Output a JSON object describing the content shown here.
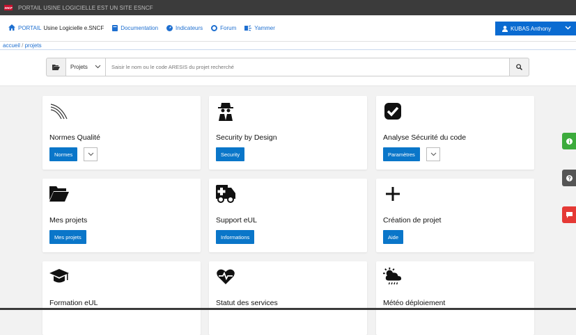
{
  "topbar": {
    "logo_text": "SNCF",
    "text": "PORTAIL USINE LOGICIELLE EST UN SITE ESNCF"
  },
  "navbar": {
    "portail": "PORTAIL",
    "usine": "Usine Logicielle e.SNCF",
    "items": [
      {
        "label": "Documentation",
        "icon": "book-icon"
      },
      {
        "label": "Indicateurs",
        "icon": "dashboard-icon"
      },
      {
        "label": "Forum",
        "icon": "forum-icon"
      },
      {
        "label": "Yammer",
        "icon": "yammer-icon"
      }
    ],
    "user": "KUBAS Anthony"
  },
  "breadcrumb": {
    "home": "accueil",
    "sep": "/",
    "current": "projets"
  },
  "search": {
    "select_value": "Projets",
    "placeholder": "Saisir le nom ou le code ARESIS du projet recherché"
  },
  "cards": [
    {
      "title": "Normes Qualité",
      "button": "Normes",
      "icon": "curves-icon",
      "has_dropdown": true
    },
    {
      "title": "Security by Design",
      "button": "Security",
      "icon": "spy-icon"
    },
    {
      "title": "Analyse Sécurité du code",
      "button": "Paramètres",
      "icon": "checkmark-icon",
      "has_dropdown": true
    },
    {
      "title": "Mes projets",
      "button": "Mes projets",
      "icon": "folder-open-icon"
    },
    {
      "title": "Support eUL",
      "button": "Informations",
      "icon": "ambulance-icon"
    },
    {
      "title": "Création de projet",
      "button": "Aide",
      "icon": "plus-icon"
    },
    {
      "title": "Formation eUL",
      "icon": "graduation-cap-icon"
    },
    {
      "title": "Statut des services",
      "icon": "heartbeat-icon"
    },
    {
      "title": "Météo déploiement",
      "icon": "weather-icon"
    }
  ],
  "colors": {
    "primary": "#0a76c9",
    "topbar": "#3b3b3b",
    "link": "#1e6fd0",
    "side_green": "#3cab3c",
    "side_dark": "#555555",
    "side_red": "#e53935"
  }
}
